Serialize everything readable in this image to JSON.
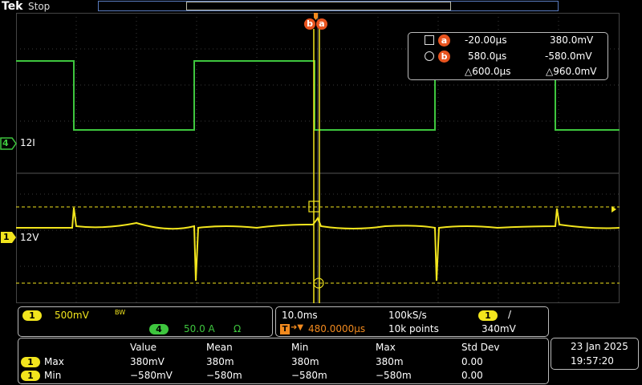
{
  "top": {
    "brand": "Tek",
    "status": "Stop"
  },
  "cursors": {
    "a": {
      "badge": "a",
      "time": "-20.00µs",
      "value": "380.0mV"
    },
    "b": {
      "badge": "b",
      "time": "580.0µs",
      "value": "-580.0mV"
    },
    "delta_time": "△600.0µs",
    "delta_value": "△960.0mV"
  },
  "channels": {
    "ch4": {
      "number": "4",
      "label": "12I",
      "color": "#3ec63e"
    },
    "ch1": {
      "number": "1",
      "label": "12V",
      "color": "#f2e51d"
    }
  },
  "cursor_badges": {
    "b": "b",
    "a": "a"
  },
  "vertical": {
    "ch1_number": "1",
    "ch1_scale": "500mV",
    "bw_icon": "BW",
    "ch4_number": "4",
    "ch4_scale": "50.0 A",
    "ch4_impedance": "Ω"
  },
  "horizontal": {
    "timebase": "10.0ms",
    "sample_rate": "100kS/s",
    "trigger_source": "1",
    "trigger_slope": "/",
    "trigger_position": "480.0000µs",
    "record_length": "10k points",
    "trigger_level": "340mV",
    "trigger_prefix": "T"
  },
  "measurements": {
    "headers": [
      "Value",
      "Mean",
      "Min",
      "Max",
      "Std Dev"
    ],
    "rows": [
      {
        "source": "1",
        "name": "Max",
        "cells": [
          "380mV",
          "380m",
          "380m",
          "380m",
          "0.00"
        ]
      },
      {
        "source": "1",
        "name": "Min",
        "cells": [
          "−580mV",
          "−580m",
          "−580m",
          "−580m",
          "0.00"
        ]
      }
    ]
  },
  "datetime": {
    "date": "23 Jan  2025",
    "time": "19:57:20"
  },
  "colors": {
    "ch1": "#f2e51d",
    "ch4": "#3ec63e",
    "cursor_accent": "#e8541f",
    "trigger": "#f28a1e"
  }
}
